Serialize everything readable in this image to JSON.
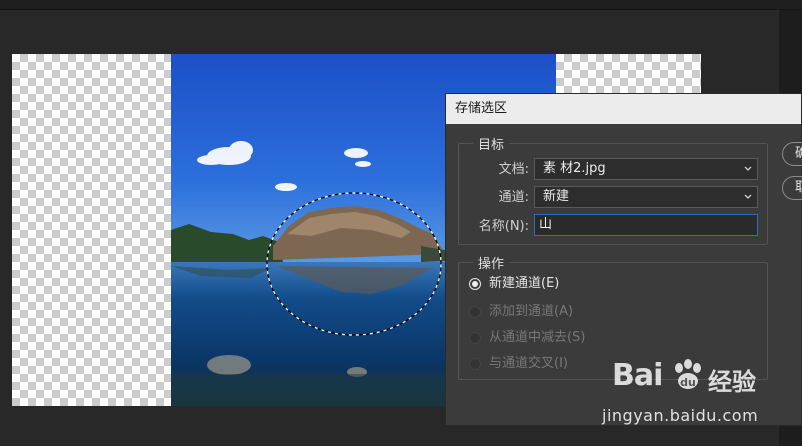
{
  "dialog": {
    "title": "存储选区",
    "target_legend": "目标",
    "document_label": "文档:",
    "document_value": "素 材2.jpg",
    "channel_label": "通道:",
    "channel_value": "新建",
    "name_label": "名称(N):",
    "name_value": "山",
    "operation_legend": "操作",
    "operations": [
      {
        "label": "新建通道(E)",
        "selected": true,
        "enabled": true
      },
      {
        "label": "添加到通道(A)",
        "selected": false,
        "enabled": false
      },
      {
        "label": "从通道中减去(S)",
        "selected": false,
        "enabled": false
      },
      {
        "label": "与通道交叉(I)",
        "selected": false,
        "enabled": false
      }
    ],
    "buttons": {
      "ok": "确",
      "cancel": "取"
    }
  },
  "watermark": {
    "logo": "Bai",
    "logo_cn": "经验",
    "url": "jingyan.baidu.com"
  },
  "colors": {
    "workspace": "#282828",
    "dialog_bg": "#3b3b3b",
    "sky_top": "#1a4fc6",
    "water": "#0d3f78",
    "input_focus": "#2f6fb9"
  }
}
